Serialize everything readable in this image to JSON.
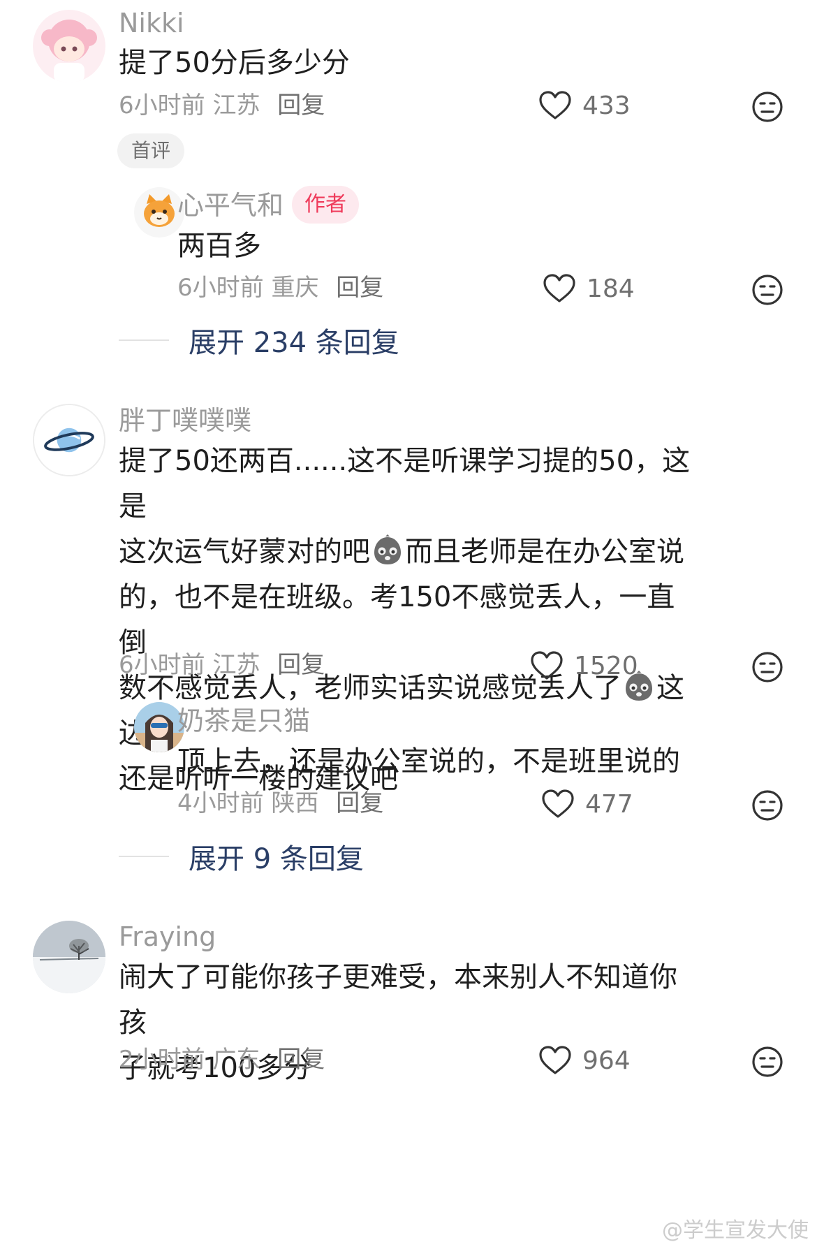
{
  "comments": [
    {
      "user": "Nikki",
      "text": "提了50分后多少分",
      "time": "6小时前",
      "region": "江苏",
      "reply_label": "回复",
      "likes": "433",
      "tag": "首评",
      "replies": [
        {
          "user": "心平气和",
          "badge": "作者",
          "text": "两百多",
          "time": "6小时前",
          "region": "重庆",
          "reply_label": "回复",
          "likes": "184"
        }
      ],
      "expand": "展开 234 条回复"
    },
    {
      "user": "胖丁噗噗噗",
      "text_lines": [
        "提了50还两百......这不是听课学习提的50，这是",
        "这次运气好蒙对的吧",
        "而且老师是在办公室说",
        "的，也不是在班级。考150不感觉丢人，一直倒",
        "数不感觉丢人，老师实话实说感觉丢人了",
        "这边",
        "还是听听一楼的建议吧"
      ],
      "time": "6小时前",
      "region": "江苏",
      "reply_label": "回复",
      "likes": "1520",
      "replies": [
        {
          "user": "奶茶是只猫",
          "text": "顶上去，还是办公室说的，不是班里说的",
          "time": "4小时前",
          "region": "陕西",
          "reply_label": "回复",
          "likes": "477"
        }
      ],
      "expand": "展开 9 条回复"
    },
    {
      "user": "Fraying",
      "text_lines": [
        "闹大了可能你孩子更难受，本来别人不知道你孩",
        "子就考100多分"
      ],
      "time": "2小时前",
      "region": "广东",
      "reply_label": "回复",
      "likes": "964"
    }
  ],
  "watermark": "@学生宣发大使",
  "icons": {
    "like": "heart-outline-icon",
    "dislike": "dislike-face-icon",
    "inline_emoji": "grumpy-emoji-icon"
  },
  "colors": {
    "author_badge_bg": "#fde9ee",
    "author_badge_text": "#ef3b5b",
    "expand_link": "#2a3e66"
  }
}
